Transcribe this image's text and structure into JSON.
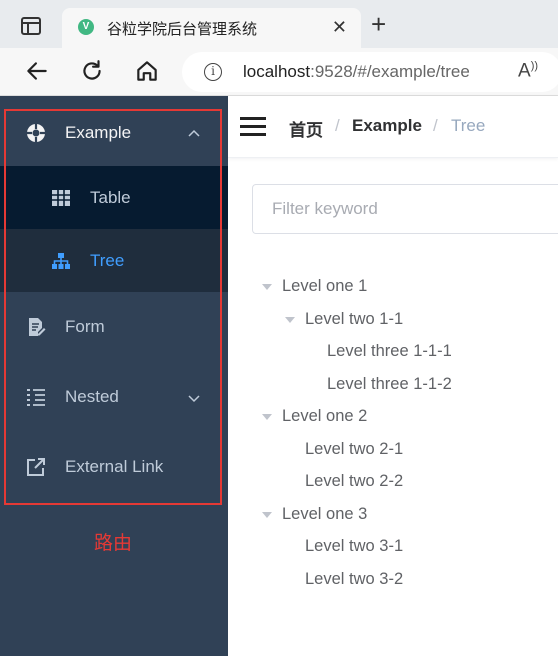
{
  "browser": {
    "tab_title": "谷粒学院后台管理系统",
    "tab_favicon": "V",
    "url_host": "localhost",
    "url_rest": ":9528/#/example/tree",
    "read_aloud": "A)"
  },
  "sidebar": {
    "items": [
      {
        "label": "Example",
        "icon": "compass-icon"
      },
      {
        "label": "Table",
        "icon": "table-icon"
      },
      {
        "label": "Tree",
        "icon": "tree-icon"
      },
      {
        "label": "Form",
        "icon": "form-icon"
      },
      {
        "label": "Nested",
        "icon": "nested-icon"
      },
      {
        "label": "External Link",
        "icon": "external-link-icon"
      }
    ],
    "note": "路由"
  },
  "breadcrumb": {
    "home": "首页",
    "sep": "/",
    "middle": "Example",
    "current": "Tree"
  },
  "filter": {
    "placeholder": "Filter keyword"
  },
  "tree": [
    {
      "label": "Level one 1"
    },
    {
      "label": "Level two 1-1"
    },
    {
      "label": "Level three 1-1-1"
    },
    {
      "label": "Level three 1-1-2"
    },
    {
      "label": "Level one 2"
    },
    {
      "label": "Level two 2-1"
    },
    {
      "label": "Level two 2-2"
    },
    {
      "label": "Level one 3"
    },
    {
      "label": "Level two 3-1"
    },
    {
      "label": "Level two 3-2"
    }
  ],
  "colors": {
    "sidebar_bg": "#304156",
    "active": "#409eff",
    "annotation": "#e53935"
  }
}
